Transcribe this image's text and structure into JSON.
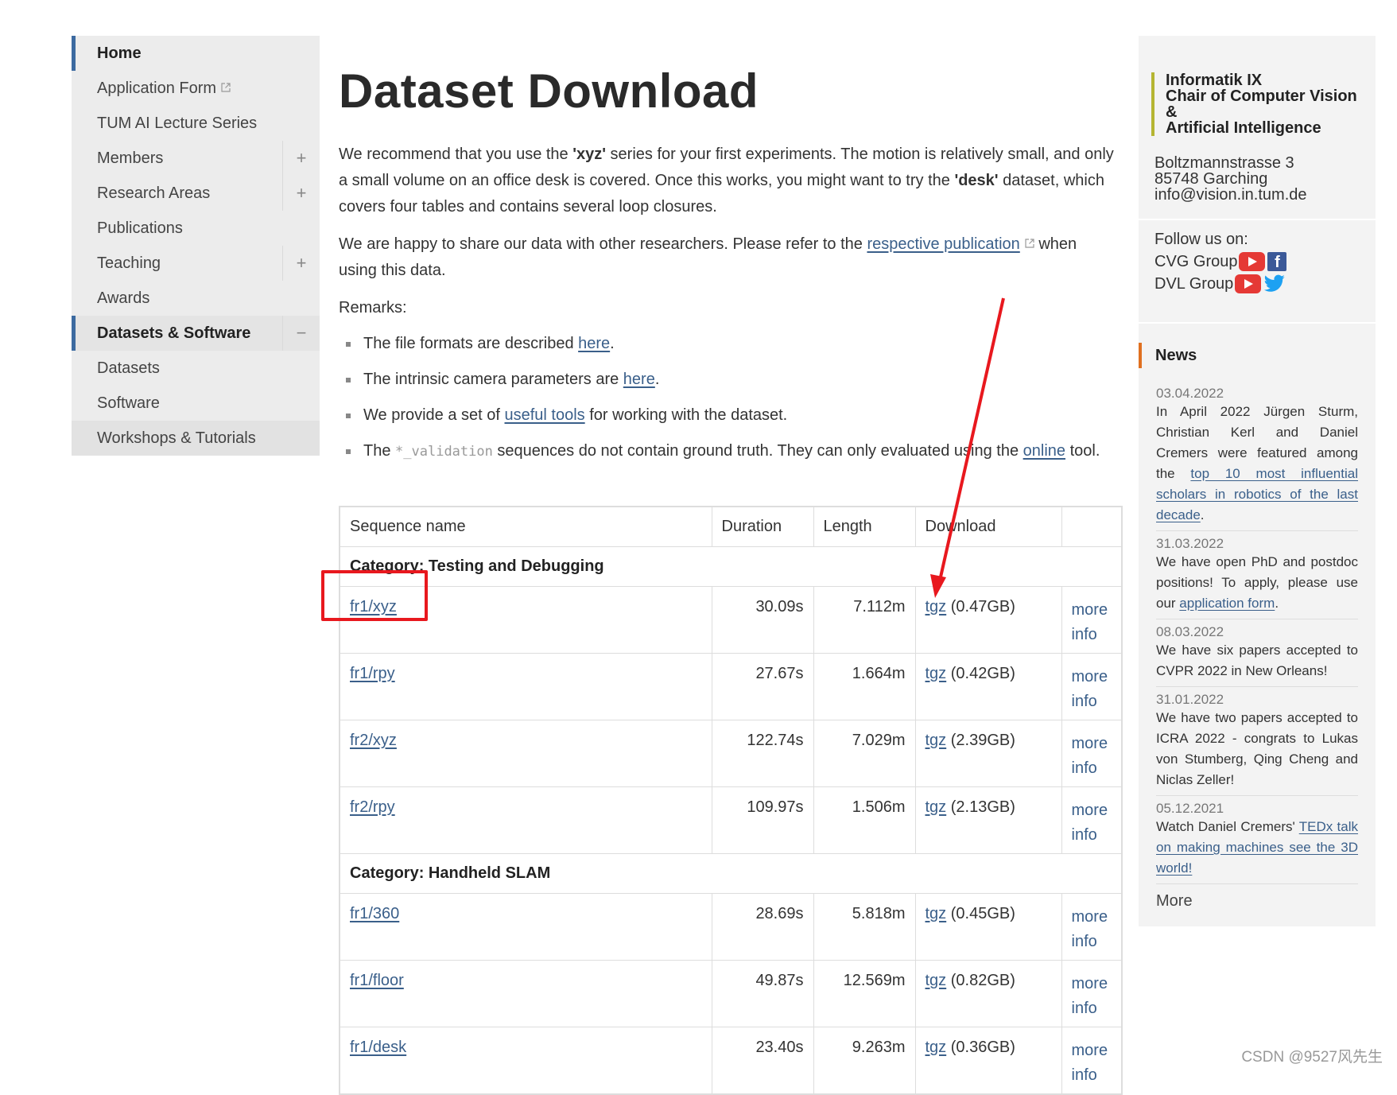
{
  "sidebar": {
    "items": [
      {
        "label": "Home"
      },
      {
        "label": "Application Form"
      },
      {
        "label": "TUM AI Lecture Series"
      },
      {
        "label": "Members",
        "toggle": "+"
      },
      {
        "label": "Research Areas",
        "toggle": "+"
      },
      {
        "label": "Publications"
      },
      {
        "label": "Teaching",
        "toggle": "+"
      },
      {
        "label": "Awards"
      },
      {
        "label": "Datasets & Software",
        "toggle": "−"
      },
      {
        "label": "Datasets"
      },
      {
        "label": "Software"
      },
      {
        "label": "Workshops & Tutorials"
      }
    ]
  },
  "main": {
    "title": "Dataset Download",
    "intro": {
      "p1_a": "We recommend that you use the ",
      "p1_xyz": "'xyz'",
      "p1_b": " series for your first experiments. The motion is relatively small, and only a small volume on an office desk is covered. Once this works, you might want to try the ",
      "p1_desk": "'desk'",
      "p1_c": " dataset, which covers four tables and contains several loop closures.",
      "p2_a": "We are happy to share our data with other researchers. Please refer to the ",
      "p2_link": "respective publication",
      "p2_b": " when using this data.",
      "remarks_label": "Remarks:"
    },
    "remarks": {
      "r1_a": "The file formats are described ",
      "r1_link": "here",
      "r1_b": ".",
      "r2_a": "The intrinsic camera parameters are ",
      "r2_link": "here",
      "r2_b": ".",
      "r3_a": "We provide a set of ",
      "r3_link": "useful tools",
      "r3_b": " for working with the dataset.",
      "r4_a": "The ",
      "r4_code": "*_validation",
      "r4_b": " sequences do not contain ground truth. They can only evaluated using the ",
      "r4_link": "online",
      "r4_c": " tool."
    },
    "table": {
      "headers": [
        "Sequence name",
        "Duration",
        "Length",
        "Download",
        ""
      ],
      "categories": [
        "Category: Testing and Debugging",
        "Category: Handheld SLAM"
      ],
      "tgz_label": "tgz",
      "more_label": "more",
      "info_label": "info",
      "rows": [
        {
          "name": "fr1/xyz",
          "duration": "30.09s",
          "length": "7.112m",
          "size": "(0.47GB)"
        },
        {
          "name": "fr1/rpy",
          "duration": "27.67s",
          "length": "1.664m",
          "size": "(0.42GB)"
        },
        {
          "name": "fr2/xyz",
          "duration": "122.74s",
          "length": "7.029m",
          "size": "(2.39GB)"
        },
        {
          "name": "fr2/rpy",
          "duration": "109.97s",
          "length": "1.506m",
          "size": "(2.13GB)"
        },
        {
          "name": "fr1/360",
          "duration": "28.69s",
          "length": "5.818m",
          "size": "(0.45GB)"
        },
        {
          "name": "fr1/floor",
          "duration": "49.87s",
          "length": "12.569m",
          "size": "(0.82GB)"
        },
        {
          "name": "fr1/desk",
          "duration": "23.40s",
          "length": "9.263m",
          "size": "(0.36GB)"
        }
      ]
    }
  },
  "right": {
    "org_line1": "Informatik IX",
    "org_line2": "Chair of Computer Vision &",
    "org_line3": "Artificial Intelligence",
    "addr1": "Boltzmannstrasse 3",
    "addr2": "85748 Garching",
    "addr3": "info@vision.in.tum.de",
    "follow_label": "Follow us on:",
    "cvg": "CVG Group",
    "dvl": "DVL Group",
    "news_title": "News",
    "news": [
      {
        "date": "03.04.2022",
        "a": "In April 2022 Jürgen Sturm, Christian Kerl and Daniel Cremers were featured among the ",
        "link": "top 10 most influential scholars in robotics of the last decade",
        "b": "."
      },
      {
        "date": "31.03.2022",
        "a": "We have open PhD and postdoc positions! To apply, please use our ",
        "link": "application form",
        "b": "."
      },
      {
        "date": "08.03.2022",
        "a": "We have six papers accepted to CVPR 2022 in New Orleans!",
        "link": "",
        "b": ""
      },
      {
        "date": "31.01.2022",
        "a": "We have two papers accepted to ICRA 2022 - congrats to Lukas von Stumberg, Qing Cheng and Niclas Zeller!",
        "link": "",
        "b": ""
      },
      {
        "date": "05.12.2021",
        "a": "Watch Daniel Cremers' ",
        "link": "TEDx talk on making machines see the 3D world!",
        "b": ""
      }
    ],
    "more": "More"
  },
  "watermark": "CSDN @9527风先生",
  "colors": {
    "nav_accent": "#3c6aa0",
    "link": "#3a5f8a",
    "annotation_red": "#e8181e",
    "org_accent": "#b5b532",
    "news_accent": "#e07020"
  }
}
